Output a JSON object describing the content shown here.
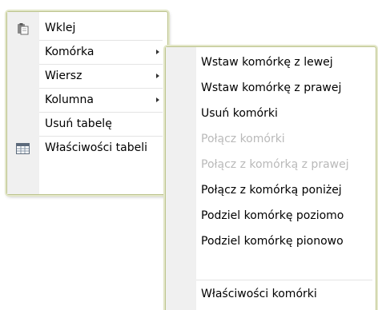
{
  "main_menu": {
    "items": [
      {
        "label": "Wklej",
        "icon": "paste-icon"
      },
      {
        "label": "Komórka",
        "submenu": true
      },
      {
        "label": "Wiersz",
        "submenu": true
      },
      {
        "label": "Kolumna",
        "submenu": true
      },
      {
        "label": "Usuń tabelę"
      },
      {
        "label": "Właściwości tabeli",
        "icon": "table-properties-icon"
      }
    ]
  },
  "cell_submenu": {
    "items": [
      {
        "label": "Wstaw komórkę z lewej"
      },
      {
        "label": "Wstaw komórkę z prawej"
      },
      {
        "label": "Usuń komórki"
      },
      {
        "label": "Połącz komórki",
        "disabled": true
      },
      {
        "label": "Połącz z komórką z prawej",
        "disabled": true
      },
      {
        "label": "Połącz z komórką poniżej"
      },
      {
        "label": "Podziel komórkę poziomo"
      },
      {
        "label": "Podziel komórkę pionowo"
      },
      {
        "label": "Właściwości komórki"
      }
    ]
  },
  "colors": {
    "menu_border": "#bdc48e",
    "icon_column": "#f0f0f0",
    "disabled_text": "#b9b9b9"
  }
}
